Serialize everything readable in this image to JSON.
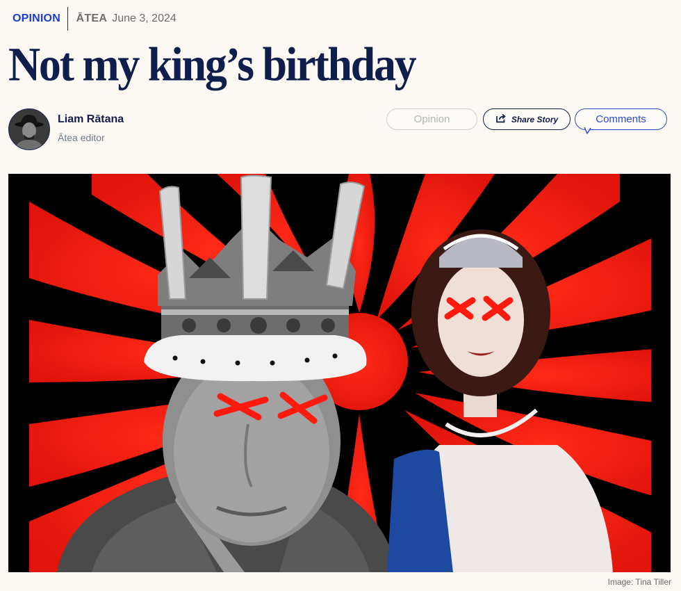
{
  "meta": {
    "section": "OPINION",
    "brand": "ĀTEA",
    "date": "June 3, 2024"
  },
  "article": {
    "title": "Not my king’s birthday"
  },
  "author": {
    "name": "Liam Rātana",
    "role": "Ātea editor"
  },
  "actions": {
    "opinion_label": "Opinion",
    "share_label": "Share Story",
    "comments_label": "Comments"
  },
  "image": {
    "caption": "Image: Tina Tiller"
  },
  "colors": {
    "accent_blue": "#1a3cd0",
    "headline_navy": "#0f1e4a",
    "hero_red": "#ff1a10",
    "page_bg": "#fcf8f4"
  },
  "icons": {
    "share": "share-icon",
    "comments": "speech-bubble-tail"
  }
}
